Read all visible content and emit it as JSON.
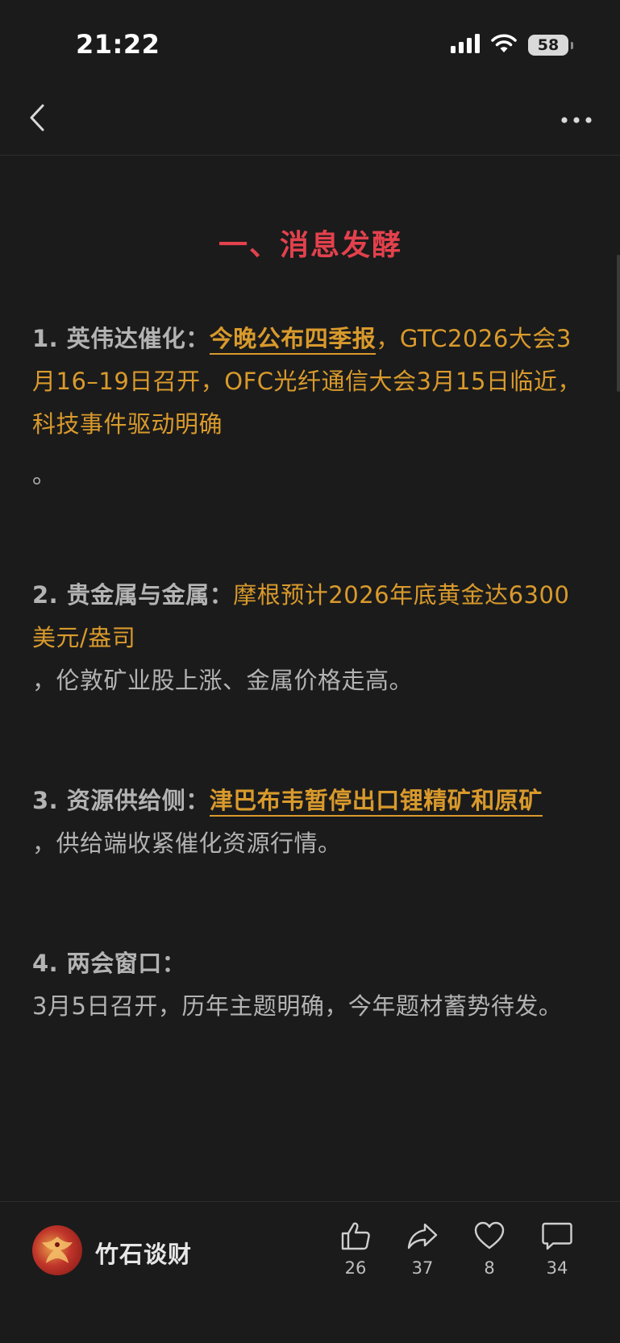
{
  "status_bar": {
    "time": "21:22",
    "battery": "58"
  },
  "article": {
    "heading": "一、消息发酵",
    "items": [
      {
        "label": "1. 英伟达催化：",
        "highlight": "今晚公布四季报",
        "rest": "，GTC2026大会3月16–19日召开，OFC光纤通信大会3月15日临近，科技事件驱动明确",
        "tail": "。"
      },
      {
        "label": "2. 贵金属与金属：",
        "highlight": "摩根预计2026年底黄金达6300美元/盎司",
        "rest": "，伦敦矿业股上涨、金属价格走高。"
      },
      {
        "label": "3. 资源供给侧：",
        "highlight": "津巴布韦暂停出口锂精矿和原矿",
        "rest": "，供给端收紧催化资源行情。"
      },
      {
        "label": "4. 两会窗口：",
        "rest": "3月5日召开，历年主题明确，今年题材蓄势待发。"
      }
    ]
  },
  "author": {
    "name": "竹石谈财"
  },
  "actions": {
    "like": {
      "icon": "thumbs-up-icon",
      "count": "26"
    },
    "share": {
      "icon": "share-icon",
      "count": "37"
    },
    "favorite": {
      "icon": "heart-icon",
      "count": "8"
    },
    "comment": {
      "icon": "comment-icon",
      "count": "34"
    }
  },
  "colors": {
    "background": "#1b1b1b",
    "heading": "#e3414d",
    "highlight": "#d99a2c",
    "body_text": "#b3b3b3"
  }
}
